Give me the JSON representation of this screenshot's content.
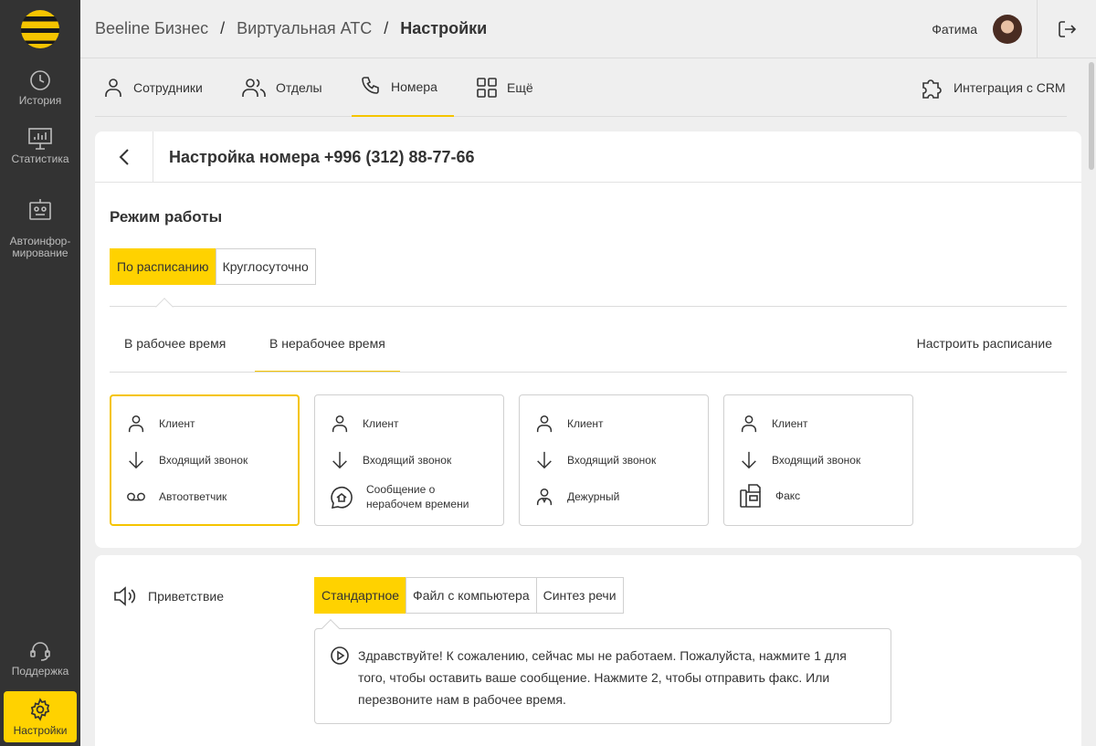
{
  "sidebar": {
    "items": [
      {
        "label": "История",
        "icon": "clock-icon"
      },
      {
        "label": "Статистика",
        "icon": "chart-icon"
      },
      {
        "label": "Автоинфор-\nмирование",
        "icon": "robot-icon"
      },
      {
        "label": "Поддержка",
        "icon": "headset-icon"
      },
      {
        "label": "Настройки",
        "icon": "gear-icon"
      }
    ]
  },
  "header": {
    "breadcrumbs": [
      "Beeline Бизнес",
      "Виртуальная АТС",
      "Настройки"
    ],
    "separator": "/",
    "user_name": "Фатима"
  },
  "tabs": [
    {
      "label": "Сотрудники",
      "icon": "person-icon"
    },
    {
      "label": "Отделы",
      "icon": "people-icon"
    },
    {
      "label": "Номера",
      "icon": "phone-icon"
    },
    {
      "label": "Ещё",
      "icon": "grid-icon"
    },
    {
      "label": "Интеграция с CRM",
      "icon": "puzzle-icon"
    }
  ],
  "settings": {
    "title": "Настройка номера +996 (312) 88-77-66",
    "mode_title": "Режим работы",
    "mode_options": [
      "По расписанию",
      "Круглосуточно"
    ],
    "mode_selected": "По расписанию",
    "subtabs": [
      "В рабочее время",
      "В нерабочее время"
    ],
    "subtab_selected": "В нерабочее время",
    "schedule_link": "Настроить расписание",
    "routes": [
      {
        "rows": [
          "Клиент",
          "Входящий звонок",
          "Автоответчик"
        ],
        "icons": [
          "person-icon",
          "arrow-down-icon",
          "voicemail-icon"
        ],
        "selected": true
      },
      {
        "rows": [
          "Клиент",
          "Входящий звонок",
          "Сообщение о нерабочем времени"
        ],
        "icons": [
          "person-icon",
          "arrow-down-icon",
          "message-house-icon"
        ],
        "selected": false
      },
      {
        "rows": [
          "Клиент",
          "Входящий звонок",
          "Дежурный"
        ],
        "icons": [
          "person-icon",
          "arrow-down-icon",
          "duty-person-icon"
        ],
        "selected": false
      },
      {
        "rows": [
          "Клиент",
          "Входящий звонок",
          "Факс"
        ],
        "icons": [
          "person-icon",
          "arrow-down-icon",
          "fax-icon"
        ],
        "selected": false
      }
    ]
  },
  "greeting": {
    "label": "Приветствие",
    "options": [
      "Стандартное",
      "Файл с компьютера",
      "Синтез речи"
    ],
    "selected": "Стандартное",
    "message": "Здравствуйте! К сожалению, сейчас мы не работаем. Пожалуйста, нажмите 1 для того, чтобы оставить ваше сообщение. Нажмите 2, чтобы отправить факс. Или перезвоните нам в рабочее время."
  },
  "colors": {
    "accent": "#ffd200",
    "sidebar": "#333333",
    "underline": "#f5c400"
  }
}
